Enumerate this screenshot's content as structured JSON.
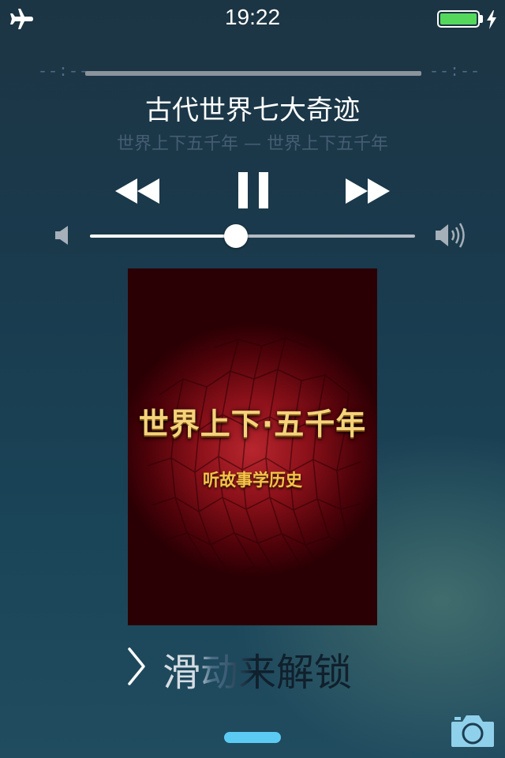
{
  "status_bar": {
    "time": "19:22",
    "airplane_icon": "airplane-icon",
    "battery_icon": "battery-icon",
    "charging_icon": "charging-icon",
    "battery_level": 1.0,
    "battery_color": "#54d85c"
  },
  "player": {
    "time_elapsed": "--:--",
    "time_remaining": "--:--",
    "title": "古代世界七大奇迹",
    "subtitle": "世界上下五千年 — 世界上下五千年",
    "controls": {
      "rewind_icon": "rewind-icon",
      "pause_icon": "pause-icon",
      "forward_icon": "fast-forward-icon"
    },
    "volume": {
      "level": 0.45,
      "low_icon": "volume-low-icon",
      "high_icon": "volume-high-icon"
    }
  },
  "album_art": {
    "title": "世界上下·五千年",
    "subtitle": "听故事学历史"
  },
  "unlock": {
    "text": "滑动来解锁",
    "chevron_icon": "chevron-right-icon"
  },
  "camera_icon": "camera-icon",
  "colors": {
    "accent": "#5ccbf3",
    "battery": "#54d85c"
  }
}
